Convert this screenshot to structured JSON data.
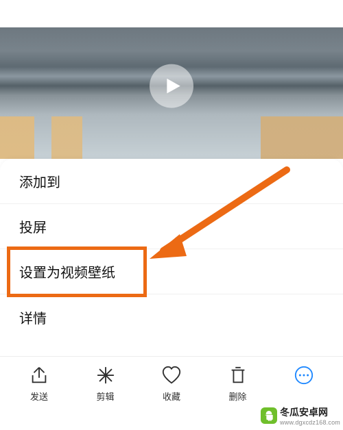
{
  "menu": {
    "items": [
      {
        "label": "添加到"
      },
      {
        "label": "投屏"
      },
      {
        "label": "设置为视频壁纸"
      },
      {
        "label": "详情"
      }
    ]
  },
  "toolbar": {
    "send": {
      "label": "发送"
    },
    "edit": {
      "label": "剪辑"
    },
    "fav": {
      "label": "收藏"
    },
    "delete": {
      "label": "删除"
    }
  },
  "watermark": {
    "title": "冬瓜安卓网",
    "url": "www.dgxcdz168.com"
  }
}
